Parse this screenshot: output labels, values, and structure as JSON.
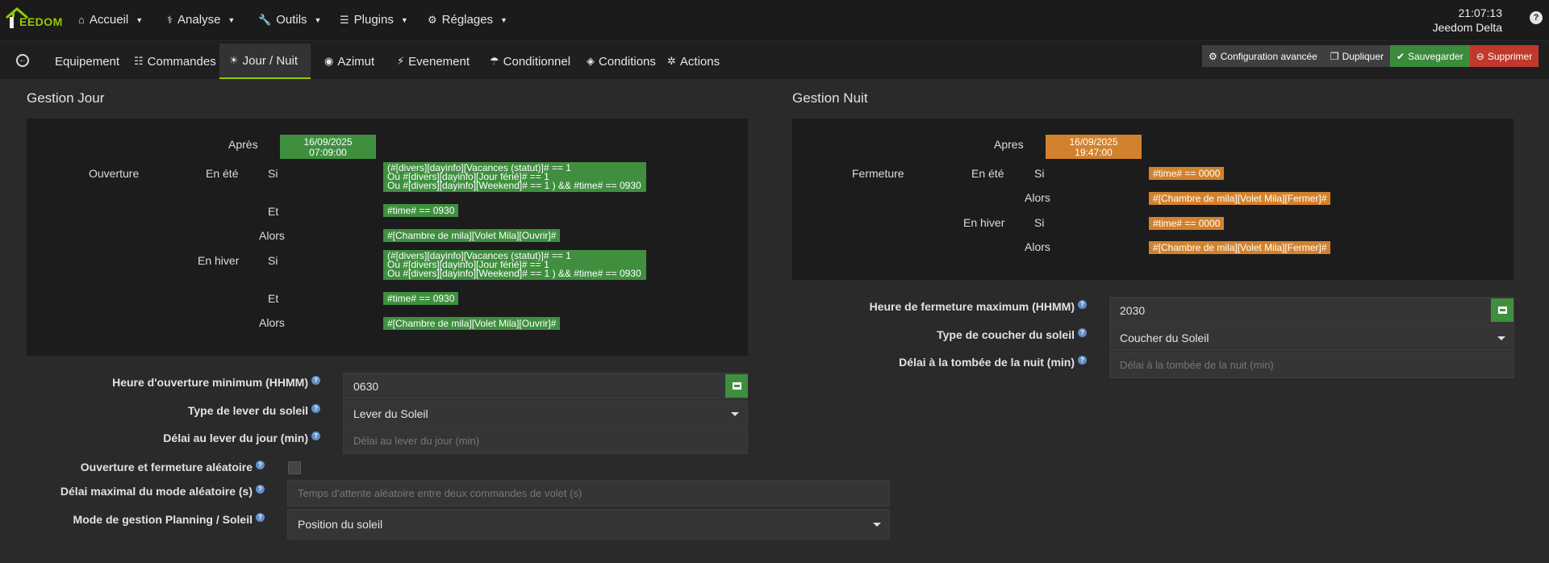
{
  "nav": {
    "brand": "EEDOM",
    "menus": [
      {
        "label": "Accueil",
        "icon": "home-icon"
      },
      {
        "label": "Analyse",
        "icon": "stethoscope-icon"
      },
      {
        "label": "Outils",
        "icon": "wrench-icon"
      },
      {
        "label": "Plugins",
        "icon": "list-icon"
      },
      {
        "label": "Réglages",
        "icon": "gear-icon"
      }
    ],
    "time": "21:07:13",
    "system": "Jeedom Delta",
    "help": "?"
  },
  "tabs": {
    "back": "←",
    "items": [
      {
        "label": "Equipement",
        "icon": ""
      },
      {
        "label": "Commandes",
        "icon": "list-icon"
      },
      {
        "label": "Jour / Nuit",
        "icon": "sun-icon"
      },
      {
        "label": "Azimut",
        "icon": "compass-icon"
      },
      {
        "label": "Evenement",
        "icon": "activity-icon"
      },
      {
        "label": "Conditionnel",
        "icon": "umbrella-icon"
      },
      {
        "label": "Conditions",
        "icon": "cube-icon"
      },
      {
        "label": "Actions",
        "icon": "cog-icon"
      }
    ]
  },
  "actions": {
    "config": "Configuration avancée",
    "duplicate": "Dupliquer",
    "save": "Sauvegarder",
    "delete": "Supprimer"
  },
  "jour": {
    "title": "Gestion Jour",
    "apres": "Après",
    "date": "16/09/2025",
    "time": "07:09:00",
    "ouverture": "Ouverture",
    "ete": "En été",
    "hiver": "En hiver",
    "si": "Si",
    "et": "Et",
    "alors": "Alors",
    "cond_l1": "(#[divers][dayinfo][Vacances (statut)]# == 1",
    "cond_l2": "Ou #[divers][dayinfo][Jour férié]# == 1",
    "cond_l3": "Ou #[divers][dayinfo][Weekend]# == 1 ) && #time# == 0930",
    "et_cond": "#time# == 0930",
    "action": "#[Chambre de mila][Volet Mila][Ouvrir]#"
  },
  "nuit": {
    "title": "Gestion Nuit",
    "apres": "Apres",
    "date": "16/09/2025",
    "time": "19:47:00",
    "fermeture": "Fermeture",
    "ete": "En été",
    "hiver": "En hiver",
    "si": "Si",
    "alors": "Alors",
    "cond": "#time# == 0000",
    "action": "#[Chambre de mila][Volet Mila][Fermer]#"
  },
  "form_jour": {
    "ouverture_min_label": "Heure d'ouverture minimum (HHMM)",
    "ouverture_min_value": "0630",
    "lever_label": "Type de lever du soleil",
    "lever_value": "Lever du Soleil",
    "delai_lever_label": "Délai au lever du jour (min)",
    "delai_lever_placeholder": "Délai au lever du jour (min)",
    "aleatoire_label": "Ouverture et fermeture aléatoire",
    "delai_alea_label": "Délai maximal du mode aléatoire (s)",
    "delai_alea_placeholder": "Temps d'attente aléatoire entre deux commandes de volet (s)",
    "mode_label": "Mode de gestion Planning / Soleil",
    "mode_value": "Position du soleil"
  },
  "form_nuit": {
    "fermeture_max_label": "Heure de fermeture maximum (HHMM)",
    "fermeture_max_value": "2030",
    "coucher_label": "Type de coucher du soleil",
    "coucher_value": "Coucher du Soleil",
    "delai_nuit_label": "Délai à la tombée de la nuit (min)",
    "delai_nuit_placeholder": "Délai à la tombée de la nuit (min)"
  },
  "colors": {
    "accent": "#94ca02",
    "green_badge": "#3f8f3f",
    "orange_badge": "#d2822d",
    "delete": "#c0392b"
  }
}
